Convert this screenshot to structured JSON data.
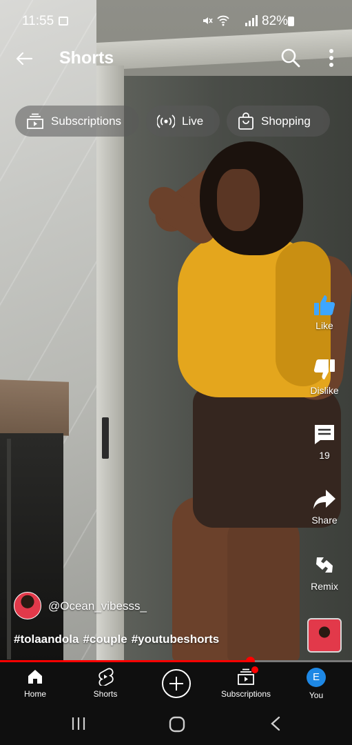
{
  "status_bar": {
    "time": "11:55",
    "battery": "82%",
    "icons": [
      "photo-icon",
      "mute-icon",
      "wifi-icon",
      "signal-icon",
      "battery-icon"
    ]
  },
  "top_bar": {
    "title": "Shorts",
    "icons": [
      "back-arrow-icon",
      "search-icon",
      "more-vert-icon"
    ]
  },
  "chips": [
    {
      "label": "Subscriptions",
      "icon": "subscriptions-icon"
    },
    {
      "label": "Live",
      "icon": "live-icon"
    },
    {
      "label": "Shopping",
      "icon": "shopping-bag-icon"
    }
  ],
  "actions": {
    "like": {
      "label": "Like",
      "icon": "thumbs-up-icon",
      "active_color": "#3ea6ff"
    },
    "dislike": {
      "label": "Dislike",
      "icon": "thumbs-down-icon"
    },
    "comments": {
      "label": "19",
      "icon": "comment-icon"
    },
    "share": {
      "label": "Share",
      "icon": "share-icon"
    },
    "remix": {
      "label": "Remix",
      "icon": "remix-icon"
    }
  },
  "video": {
    "channel": "@Ocean_vibesss_",
    "hashtags": [
      "#tolaandola",
      "#couple",
      "#youtubeshorts"
    ],
    "progress": 0.71
  },
  "bottom_nav": {
    "items": [
      {
        "label": "Home",
        "icon": "home-icon"
      },
      {
        "label": "Shorts",
        "icon": "shorts-icon"
      },
      {
        "label": "",
        "icon": "create-plus-icon"
      },
      {
        "label": "Subscriptions",
        "icon": "subscriptions-icon"
      },
      {
        "label": "You",
        "icon": "avatar"
      }
    ],
    "you_initial": "E"
  },
  "system_nav": [
    "recents-icon",
    "home-circle-icon",
    "back-chevron-icon"
  ],
  "colors": {
    "accent_red": "#ff0000",
    "like_blue": "#3ea6ff",
    "nav_bg": "#0f0f0f",
    "avatar_blue": "#1e88e5"
  }
}
